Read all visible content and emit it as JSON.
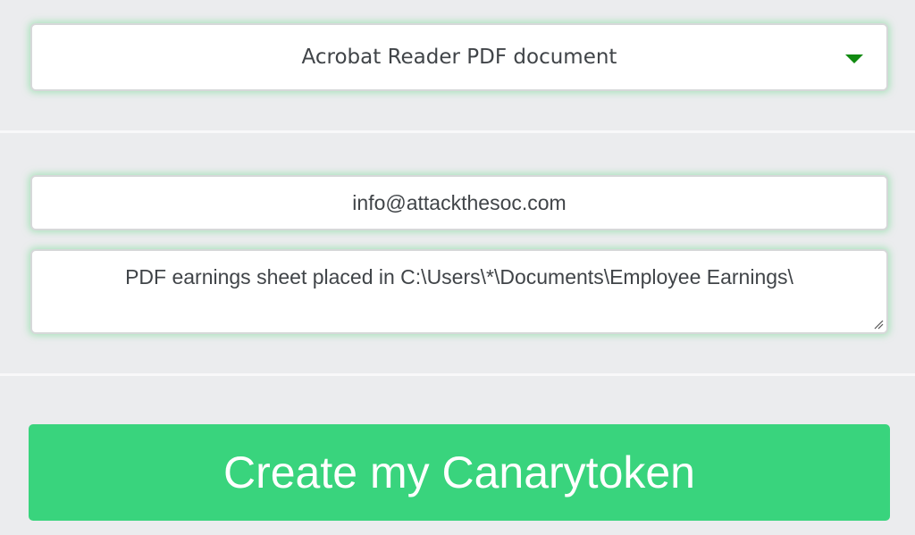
{
  "token_type_select": {
    "selected": "Acrobat Reader PDF document",
    "arrow_icon": "caret-down-icon",
    "arrow_color": "#118a11"
  },
  "email_field": {
    "value": "info@attackthesoc.com"
  },
  "memo_field": {
    "value": "PDF earnings sheet placed in C:\\Users\\*\\Documents\\Employee Earnings\\"
  },
  "create_button": {
    "label": "Create my Canarytoken",
    "color": "#39d47d"
  },
  "colors": {
    "background": "#ebecee",
    "focus_glow": "#78dc96",
    "text": "#404448"
  }
}
